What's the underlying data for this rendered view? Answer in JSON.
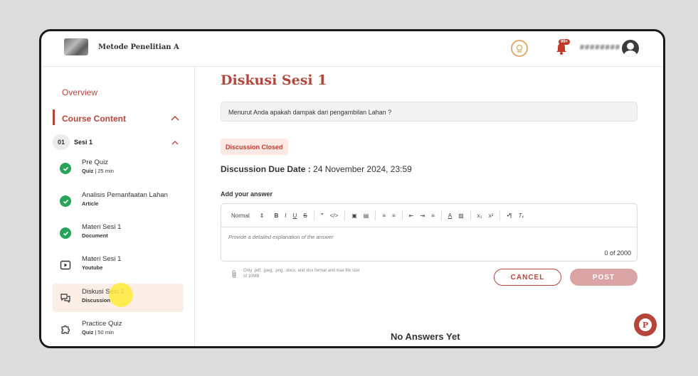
{
  "header": {
    "course_title": "Metode Penelitian A",
    "notification_count": "99+",
    "username": "########"
  },
  "sidebar": {
    "overview": "Overview",
    "course_content": "Course Content",
    "section": {
      "number": "01",
      "title": "Sesi 1"
    },
    "items": [
      {
        "title": "Pre Quiz",
        "type": "Quiz",
        "meta": " | 25 min",
        "icon": "check-icon",
        "status": "completed"
      },
      {
        "title": "Analisis Pemanfaatan Lahan",
        "type": "Article",
        "meta": "",
        "icon": "check-icon",
        "status": "completed"
      },
      {
        "title": "Materi Sesi 1",
        "type": "Document",
        "meta": "",
        "icon": "check-icon",
        "status": "completed"
      },
      {
        "title": "Materi Sesi 1",
        "type": "Youtube",
        "meta": "",
        "icon": "video-icon",
        "status": "pending"
      },
      {
        "title": "Diskusi Sesi 1",
        "type": "Discussion",
        "meta": "",
        "icon": "chat-icon",
        "status": "active"
      },
      {
        "title": "Practice Quiz",
        "type": "Quiz",
        "meta": " | 50 min",
        "icon": "puzzle-icon",
        "status": "pending"
      }
    ]
  },
  "main": {
    "title": "Diskusi Sesi 1",
    "question": "Menurut Anda apakah dampak dari pengambilan Lahan ?",
    "status_badge": "Discussion Closed",
    "due_label": "Discussion Due Date :",
    "due_value": " 24 November 2024, 23:59",
    "add_answer_label": "Add your answer",
    "editor": {
      "format_select": "Normal",
      "placeholder": "Provide a detailed explanation of the answer",
      "char_count": "0 of 2000"
    },
    "file_note": "Only .pdf, .jpeg, .png, .docx, and xlsx format and max file size of 10MB",
    "cancel_label": "CANCEL",
    "post_label": "POST",
    "no_answers": "No Answers Yet"
  },
  "colors": {
    "accent": "#b5453b",
    "success": "#27a35a",
    "active_bg": "#fbeee6",
    "post_disabled": "#dba4a4"
  }
}
